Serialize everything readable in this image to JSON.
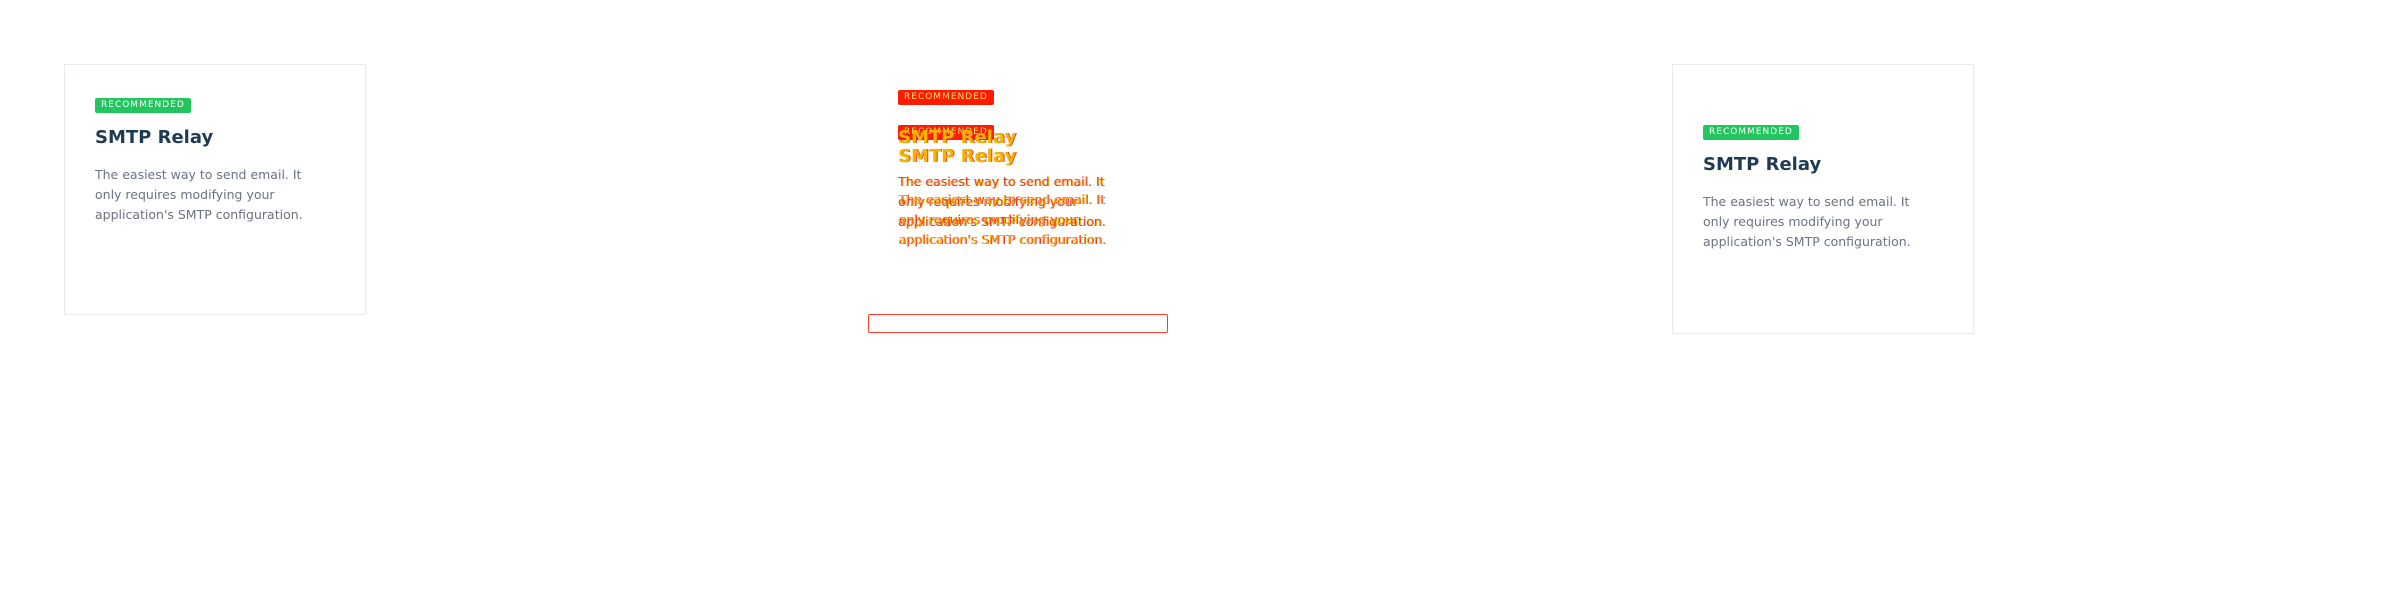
{
  "cards": [
    {
      "badge": "RECOMMENDED",
      "title": "SMTP Relay",
      "description": "The easiest way to send email. It only requires modifying your application's SMTP configuration."
    },
    {
      "badge": "RECOMMENDED",
      "title": "SMTP Relay",
      "description": "The easiest way to send email. It only requires modifying your application's SMTP configuration."
    },
    {
      "badge": "RECOMMENDED",
      "title": "SMTP Relay",
      "description": "The easiest way to send email. It only requires modifying your application's SMTP configuration."
    }
  ],
  "colors": {
    "badge_green": "#22c55e",
    "title": "#1f3a55",
    "description": "#6b7280",
    "overlay_red": "#ff1a00",
    "overlay_yellow": "#f4b400"
  }
}
